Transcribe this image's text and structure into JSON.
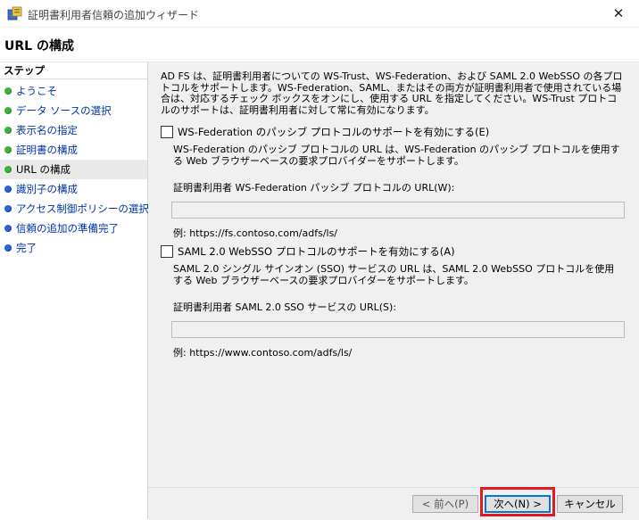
{
  "window": {
    "title": "証明書利用者信頼の追加ウィザード",
    "close_glyph": "✕"
  },
  "page_title": "URL の構成",
  "sidebar": {
    "heading": "ステップ",
    "items": [
      {
        "label": "ようこそ",
        "status": "done"
      },
      {
        "label": "データ ソースの選択",
        "status": "done"
      },
      {
        "label": "表示名の指定",
        "status": "done"
      },
      {
        "label": "証明書の構成",
        "status": "done"
      },
      {
        "label": "URL の構成",
        "status": "current"
      },
      {
        "label": "識別子の構成",
        "status": "pending"
      },
      {
        "label": "アクセス制御ポリシーの選択",
        "status": "pending"
      },
      {
        "label": "信頼の追加の準備完了",
        "status": "pending"
      },
      {
        "label": "完了",
        "status": "pending"
      }
    ]
  },
  "main": {
    "intro": "AD FS は、証明書利用者についての WS-Trust、WS-Federation、および SAML 2.0 WebSSO の各プロトコルをサポートします。WS-Federation、SAML、またはその両方が証明書利用者で使用されている場合は、対応するチェック ボックスをオンにし、使用する URL を指定してください。WS-Trust プロトコルのサポートは、証明書利用者に対して常に有効になります。",
    "wsfed": {
      "checkbox_label": "WS-Federation のパッシブ プロトコルのサポートを有効にする(E)",
      "checked": false,
      "description": "WS-Federation のパッシブ プロトコルの URL は、WS-Federation のパッシブ プロトコルを使用する Web ブラウザーベースの要求プロバイダーをサポートします。",
      "field_label": "証明書利用者 WS-Federation パッシブ プロトコルの URL(W):",
      "field_value": "",
      "example": "例: https://fs.contoso.com/adfs/ls/"
    },
    "saml": {
      "checkbox_label": "SAML 2.0 WebSSO プロトコルのサポートを有効にする(A)",
      "checked": false,
      "description": "SAML 2.0 シングル サインオン (SSO) サービスの URL は、SAML 2.0 WebSSO プロトコルを使用する Web ブラウザーベースの要求プロバイダーをサポートします。",
      "field_label": "証明書利用者 SAML 2.0 SSO サービスの URL(S):",
      "field_value": "",
      "example": "例: https://www.contoso.com/adfs/ls/"
    }
  },
  "footer": {
    "back_label": "< 前へ(P)",
    "next_label": "次へ(N) >",
    "cancel_label": "キャンセル"
  },
  "colors": {
    "highlight": "#e01b24",
    "step_done": "#3cb43c",
    "step_pending": "#2c62d6",
    "link": "#0033aa"
  }
}
